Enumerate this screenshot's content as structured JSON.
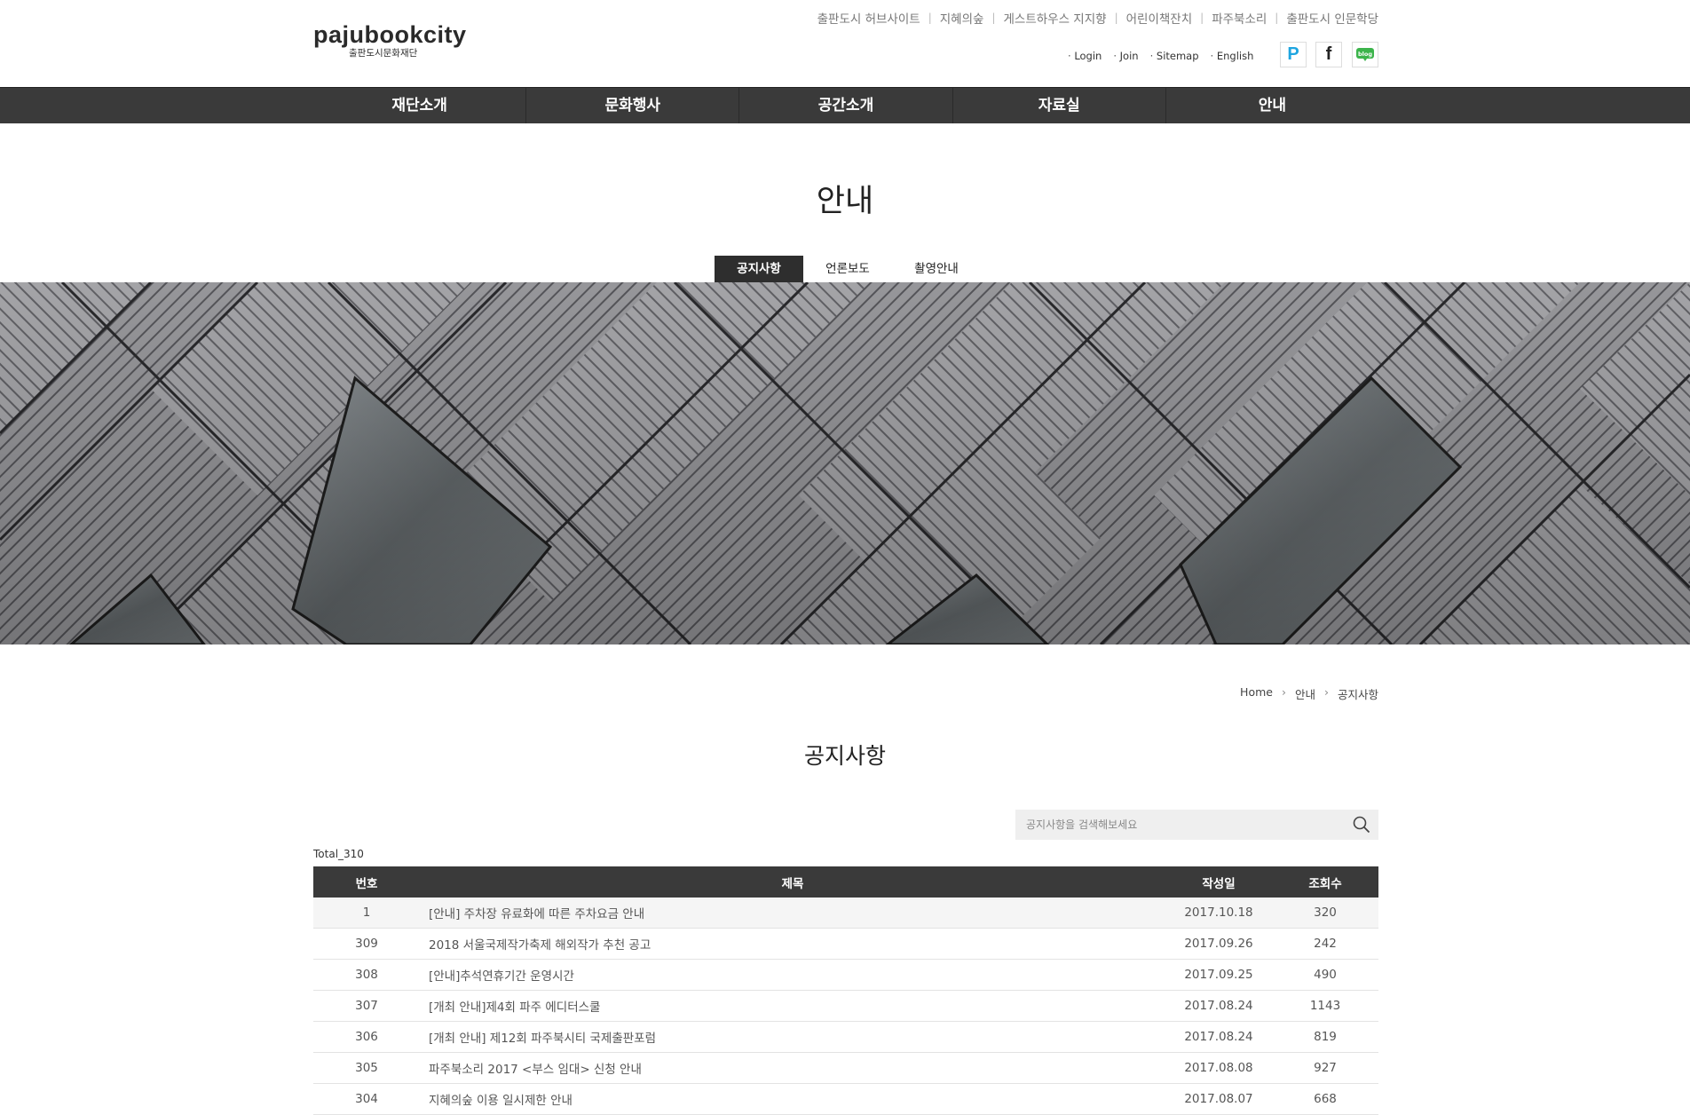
{
  "header": {
    "logo_main": "pajubookcity",
    "logo_sub": "출판도시문화재단",
    "util_links": [
      "출판도시 허브사이트",
      "지혜의숲",
      "게스트하우스 지지향",
      "어린이책잔치",
      "파주북소리",
      "출판도시 인문학당"
    ],
    "member_links": [
      "Login",
      "Join",
      "Sitemap",
      "English"
    ],
    "sns": [
      "P",
      "f",
      "blog"
    ]
  },
  "gnb": [
    "재단소개",
    "문화행사",
    "공간소개",
    "자료실",
    "안내"
  ],
  "page_title": "안내",
  "subtabs": [
    "공지사항",
    "언론보도",
    "촬영안내"
  ],
  "breadcrumb": [
    "Home",
    "안내",
    "공지사항"
  ],
  "board_title": "공지사항",
  "search": {
    "placeholder": "공지사항을 검색해보세요"
  },
  "total": "Total_310",
  "table": {
    "headers": [
      "번호",
      "제목",
      "작성일",
      "조회수"
    ],
    "rows": [
      {
        "num": "1",
        "title": "[안내] 주차장 유료화에 따른 주차요금 안내",
        "date": "2017.10.18",
        "views": "320"
      },
      {
        "num": "309",
        "title": "2018 서울국제작가축제 해외작가 추천 공고",
        "date": "2017.09.26",
        "views": "242"
      },
      {
        "num": "308",
        "title": "[안내]추석연휴기간 운영시간",
        "date": "2017.09.25",
        "views": "490"
      },
      {
        "num": "307",
        "title": "[개최 안내]제4회 파주 에디터스쿨",
        "date": "2017.08.24",
        "views": "1143"
      },
      {
        "num": "306",
        "title": "[개최 안내] 제12회 파주북시티 국제출판포럼",
        "date": "2017.08.24",
        "views": "819"
      },
      {
        "num": "305",
        "title": "파주북소리 2017 <부스 임대> 신청 안내",
        "date": "2017.08.08",
        "views": "927"
      },
      {
        "num": "304",
        "title": "지혜의숲 이용 일시제한 안내",
        "date": "2017.08.07",
        "views": "668"
      }
    ]
  }
}
